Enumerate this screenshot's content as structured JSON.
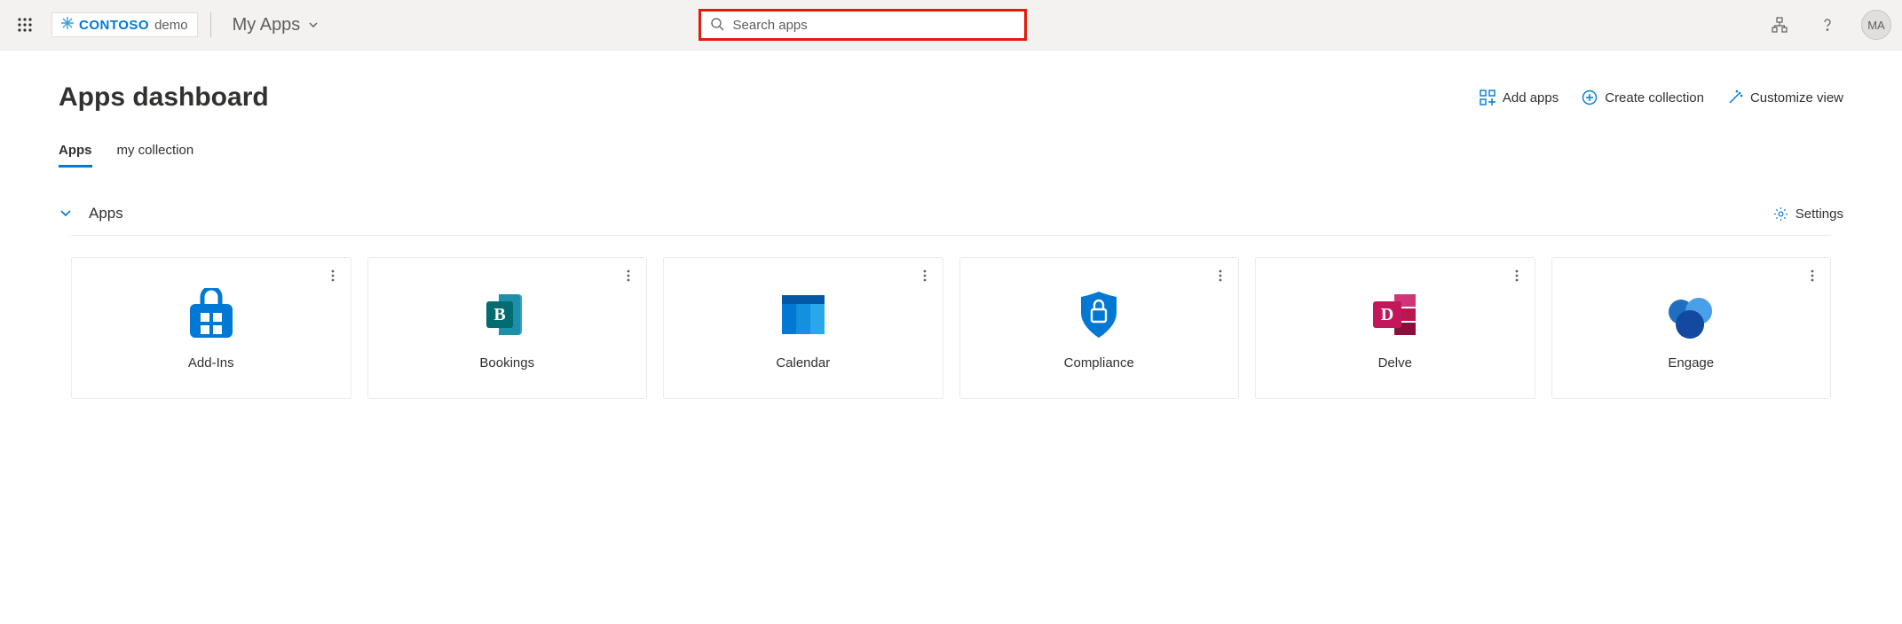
{
  "header": {
    "brand": "CONTOSO",
    "brand_suffix": "demo",
    "nav_label": "My Apps",
    "search_placeholder": "Search apps",
    "avatar_initials": "MA"
  },
  "page": {
    "title": "Apps dashboard",
    "actions": {
      "add_apps": "Add apps",
      "create_collection": "Create collection",
      "customize_view": "Customize view"
    },
    "tabs": [
      {
        "label": "Apps",
        "active": true
      },
      {
        "label": "my collection",
        "active": false
      }
    ],
    "section": {
      "title": "Apps",
      "settings_label": "Settings"
    },
    "apps": [
      {
        "label": "Add-Ins",
        "icon": "addins"
      },
      {
        "label": "Bookings",
        "icon": "bookings"
      },
      {
        "label": "Calendar",
        "icon": "calendar"
      },
      {
        "label": "Compliance",
        "icon": "compliance"
      },
      {
        "label": "Delve",
        "icon": "delve"
      },
      {
        "label": "Engage",
        "icon": "engage"
      }
    ]
  },
  "colors": {
    "accent": "#0078d4",
    "highlight_border": "#e31b0c"
  }
}
